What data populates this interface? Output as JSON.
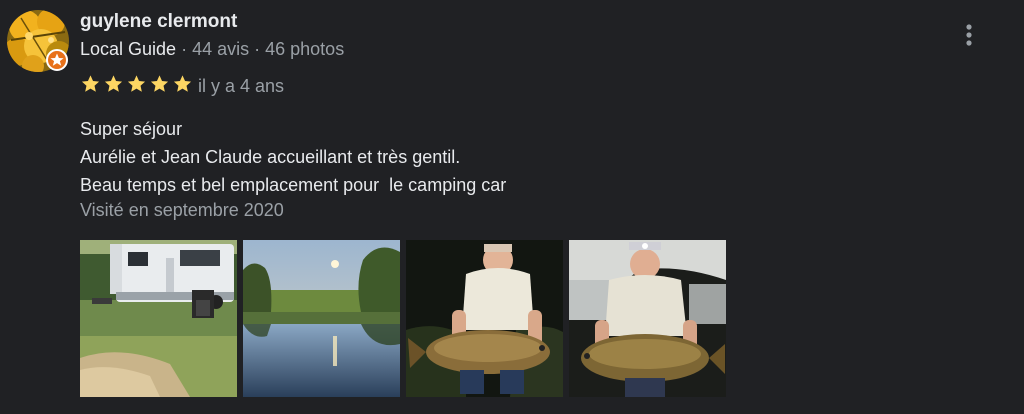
{
  "review": {
    "author": {
      "name": "guylene clermont",
      "guide_label": "Local Guide",
      "reviews_count": "44 avis",
      "photos_count": "46 photos",
      "separator": " · ",
      "avatar_icon": "autumn-leaves-avatar",
      "badge_icon": "local-guide-star-badge"
    },
    "rating": {
      "value": 5,
      "max": 5,
      "star_color": "#fdd663"
    },
    "date": "il y a 4 ans",
    "text_lines": [
      "Super séjour",
      "Aurélie et Jean Claude accueillant et très gentil.",
      "Beau temps et bel emplacement pour  le camping car"
    ],
    "visited": "Visité en septembre 2020",
    "photos": [
      {
        "icon": "camper-van-photo"
      },
      {
        "icon": "pond-sunset-photo"
      },
      {
        "icon": "man-holding-carp-night-photo"
      },
      {
        "icon": "man-holding-carp-headlamp-photo"
      }
    ],
    "menu_icon": "more-vert-icon"
  },
  "colors": {
    "background": "#202124",
    "text_primary": "#e8eaed",
    "text_secondary": "#9aa0a6",
    "badge": "#e8711a"
  }
}
